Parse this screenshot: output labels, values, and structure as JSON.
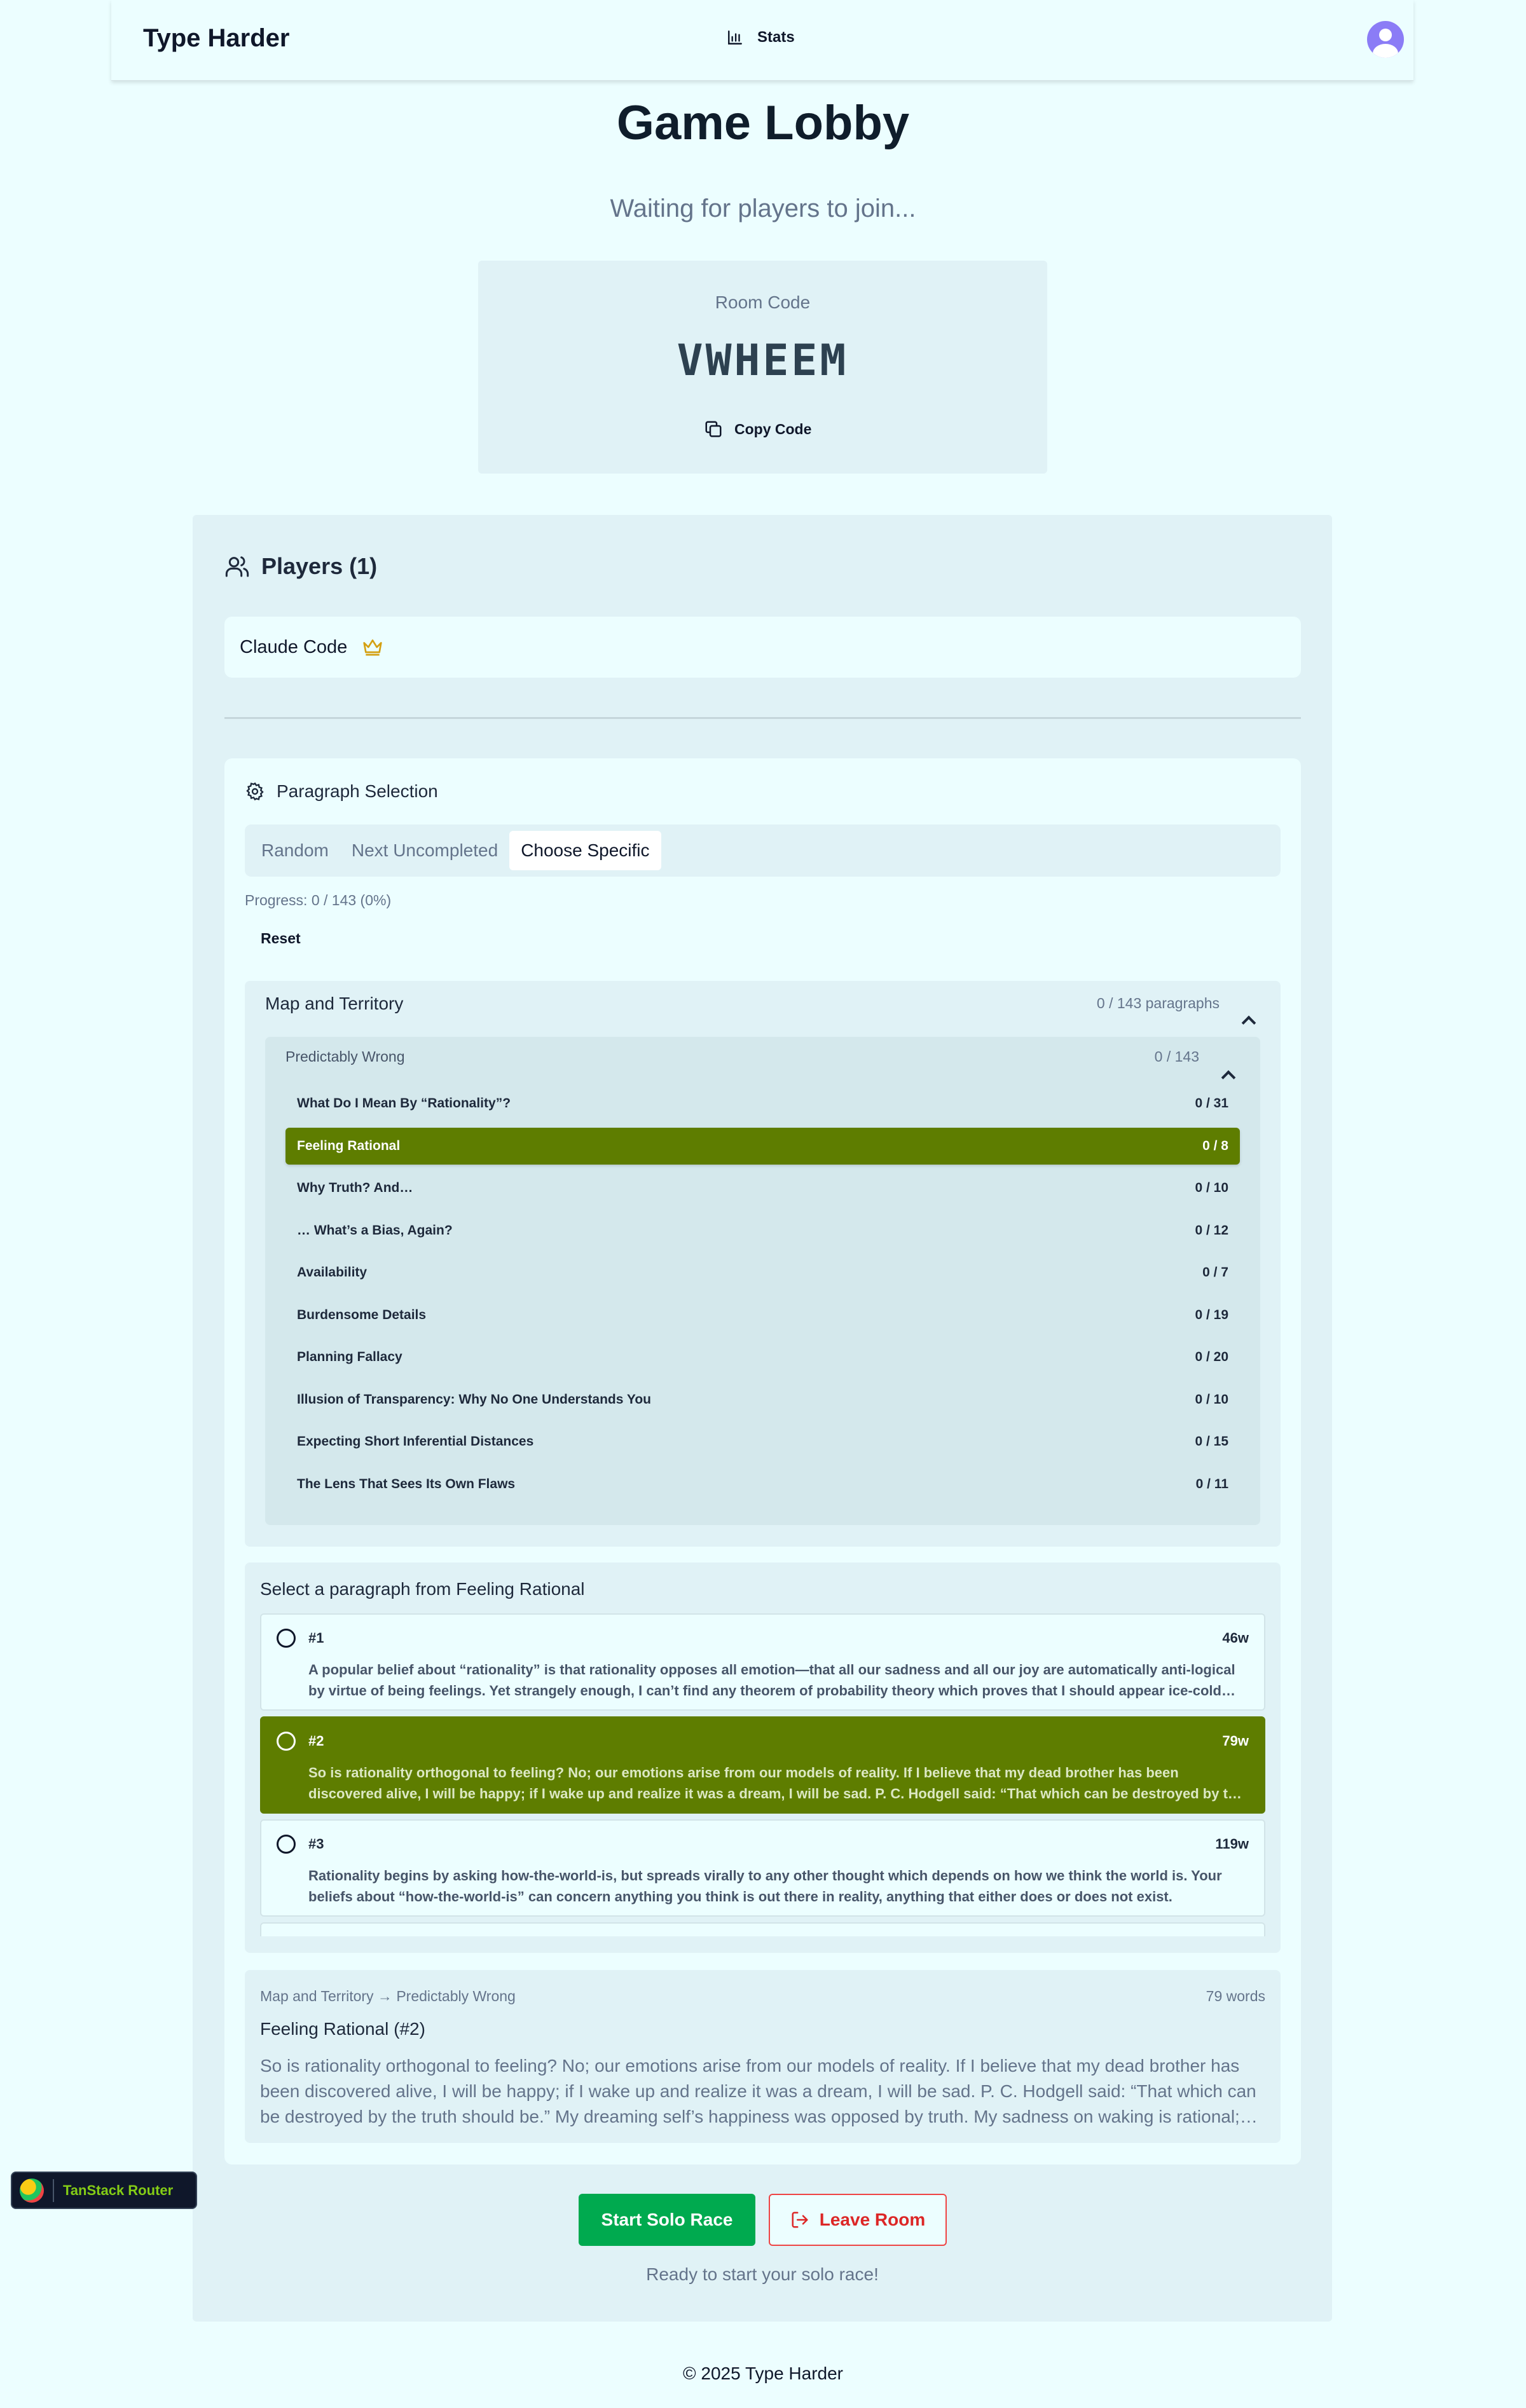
{
  "header": {
    "brand": "Type Harder",
    "stats_label": "Stats"
  },
  "lobby": {
    "title": "Game Lobby",
    "subtitle": "Waiting for players to join...",
    "room_code_label": "Room Code",
    "room_code": "VWHEEM",
    "copy_label": "Copy Code"
  },
  "players": {
    "heading": "Players (1)",
    "list": [
      {
        "name": "Claude Code",
        "host": true
      }
    ]
  },
  "selection": {
    "heading": "Paragraph Selection",
    "tabs": [
      {
        "label": "Random",
        "active": false
      },
      {
        "label": "Next Uncompleted",
        "active": false
      },
      {
        "label": "Choose Specific",
        "active": true
      }
    ],
    "progress": "Progress: 0 / 143 (0%)",
    "reset_label": "Reset",
    "book": {
      "title": "Map and Territory",
      "count": "0 / 143 paragraphs",
      "sequence": {
        "title": "Predictably Wrong",
        "count": "0 / 143",
        "posts": [
          {
            "title": "What Do I Mean By “Rationality”?",
            "count": "0 / 31",
            "selected": false
          },
          {
            "title": "Feeling Rational",
            "count": "0 / 8",
            "selected": true
          },
          {
            "title": "Why Truth? And…",
            "count": "0 / 10",
            "selected": false
          },
          {
            "title": "… What’s a Bias, Again?",
            "count": "0 / 12",
            "selected": false
          },
          {
            "title": "Availability",
            "count": "0 / 7",
            "selected": false
          },
          {
            "title": "Burdensome Details",
            "count": "0 / 19",
            "selected": false
          },
          {
            "title": "Planning Fallacy",
            "count": "0 / 20",
            "selected": false
          },
          {
            "title": "Illusion of Transparency: Why No One Understands You",
            "count": "0 / 10",
            "selected": false
          },
          {
            "title": "Expecting Short Inferential Distances",
            "count": "0 / 15",
            "selected": false
          },
          {
            "title": "The Lens That Sees Its Own Flaws",
            "count": "0 / 11",
            "selected": false
          }
        ]
      }
    },
    "paragraphs": {
      "heading": "Select a paragraph from Feeling Rational",
      "items": [
        {
          "num": "#1",
          "words": "46w",
          "selected": false,
          "text": "A popular belief about “rationality” is that rationality opposes all emotion—that all our sadness and all our joy are automatically anti-logical by virtue of being feelings. Yet strangely enough, I can’t find any theorem of probability theory which proves that I should appear ice-cold and expressionless."
        },
        {
          "num": "#2",
          "words": "79w",
          "selected": true,
          "text": "So is rationality orthogonal to feeling? No; our emotions arise from our models of reality. If I believe that my dead brother has been discovered alive, I will be happy; if I wake up and realize it was a dream, I will be sad. P. C. Hodgell said: “That which can be destroyed by the truth should be.”"
        },
        {
          "num": "#3",
          "words": "119w",
          "selected": false,
          "text": "Rationality begins by asking how-the-world-is, but spreads virally to any other thought which depends on how we think the world is. Your beliefs about “how-the-world-is” can concern anything you think is out there in reality, anything that either does or does not exist."
        },
        {
          "num": "#4",
          "words": "",
          "selected": false,
          "text": ""
        }
      ]
    },
    "preview": {
      "breadcrumb": "Map and Territory → Predictably Wrong",
      "word_count": "79 words",
      "title": "Feeling Rational (#2)",
      "text": "So is rationality orthogonal to feeling? No; our emotions arise from our models of reality. If I believe that my dead brother has been discovered alive, I will be happy; if I wake up and realize it was a dream, I will be sad. P. C. Hodgell said: “That which can be destroyed by the truth should be.” My dreaming self’s happiness was opposed by truth. My sadness on waking is rational; there is no truth which destroys it."
    }
  },
  "actions": {
    "start_label": "Start Solo Race",
    "leave_label": "Leave Room",
    "status": "Ready to start your solo race!"
  },
  "devtools": {
    "label": "TanStack Router"
  },
  "footer": {
    "text": "© 2025 Type Harder"
  }
}
